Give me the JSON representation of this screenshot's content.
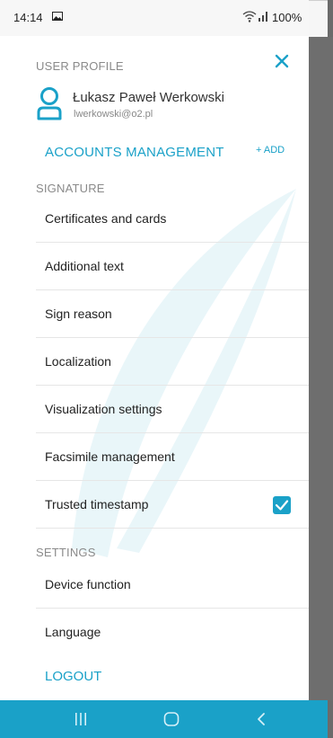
{
  "status_bar": {
    "time": "14:14",
    "battery": "100%",
    "icons": [
      "image-icon",
      "wifi-icon",
      "signal-icon",
      "battery-icon"
    ]
  },
  "profile": {
    "section_label": "USER PROFILE",
    "name": "Łukasz Paweł Werkowski",
    "email": "lwerkowski@o2.pl"
  },
  "accounts": {
    "label": "ACCOUNTS MANAGEMENT",
    "add_label": "+ ADD"
  },
  "signature": {
    "section_label": "SIGNATURE",
    "items": [
      {
        "label": "Certificates and cards"
      },
      {
        "label": "Additional text"
      },
      {
        "label": "Sign reason"
      },
      {
        "label": "Localization"
      },
      {
        "label": "Visualization settings"
      },
      {
        "label": "Facsimile management"
      },
      {
        "label": "Trusted timestamp",
        "checked": true
      }
    ]
  },
  "settings": {
    "section_label": "SETTINGS",
    "items": [
      {
        "label": "Device function"
      },
      {
        "label": "Language"
      }
    ]
  },
  "logout_label": "LOGOUT",
  "colors": {
    "accent": "#1aa1c8",
    "scrim": "#6e6e6e",
    "divider": "#e6e6e6"
  },
  "nav_bar": {
    "buttons": [
      "recents-icon",
      "home-icon",
      "back-icon"
    ]
  }
}
